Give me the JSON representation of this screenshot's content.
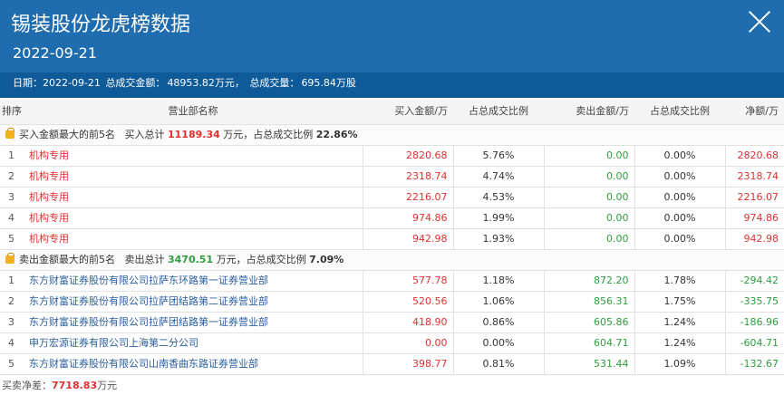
{
  "header": {
    "title": "锡装股份龙虎榜数据",
    "date": "2022-09-21",
    "summary": {
      "date_label": "日期：2022-09-21",
      "amount_label": "总成交金额：",
      "amount_value": "48953.82万元，",
      "volume_label": "总成交量：",
      "volume_value": "695.84万股"
    }
  },
  "table": {
    "headers": {
      "rank": "排序",
      "name": "营业部名称",
      "buy_amount": "买入金额/万",
      "buy_ratio": "占总成交比例",
      "sell_amount": "卖出金额/万",
      "sell_ratio": "占总成交比例",
      "net": "净额/万"
    },
    "buy_group": {
      "label": "买入金额最大的前5名",
      "total_label": "买入总计",
      "total_value": "11189.34",
      "unit_label": "万元，占总成交比例",
      "ratio_value": "22.86%",
      "rows": [
        {
          "rank": "1",
          "name": "机构专用",
          "buy": "2820.68",
          "buy_pct": "5.76%",
          "sell": "0.00",
          "sell_pct": "0.00%",
          "net": "2820.68"
        },
        {
          "rank": "2",
          "name": "机构专用",
          "buy": "2318.74",
          "buy_pct": "4.74%",
          "sell": "0.00",
          "sell_pct": "0.00%",
          "net": "2318.74"
        },
        {
          "rank": "3",
          "name": "机构专用",
          "buy": "2216.07",
          "buy_pct": "4.53%",
          "sell": "0.00",
          "sell_pct": "0.00%",
          "net": "2216.07"
        },
        {
          "rank": "4",
          "name": "机构专用",
          "buy": "974.86",
          "buy_pct": "1.99%",
          "sell": "0.00",
          "sell_pct": "0.00%",
          "net": "974.86"
        },
        {
          "rank": "5",
          "name": "机构专用",
          "buy": "942.98",
          "buy_pct": "1.93%",
          "sell": "0.00",
          "sell_pct": "0.00%",
          "net": "942.98"
        }
      ]
    },
    "sell_group": {
      "label": "卖出金额最大的前5名",
      "total_label": "卖出总计",
      "total_value": "3470.51",
      "unit_label": "万元，占总成交比例",
      "ratio_value": "7.09%",
      "rows": [
        {
          "rank": "1",
          "name": "东方财富证券股份有限公司拉萨东环路第一证券营业部",
          "buy": "577.78",
          "buy_pct": "1.18%",
          "sell": "872.20",
          "sell_pct": "1.78%",
          "net": "-294.42"
        },
        {
          "rank": "2",
          "name": "东方财富证券股份有限公司拉萨团结路第二证券营业部",
          "buy": "520.56",
          "buy_pct": "1.06%",
          "sell": "856.31",
          "sell_pct": "1.75%",
          "net": "-335.75"
        },
        {
          "rank": "3",
          "name": "东方财富证券股份有限公司拉萨团结路第一证券营业部",
          "buy": "418.90",
          "buy_pct": "0.86%",
          "sell": "605.86",
          "sell_pct": "1.24%",
          "net": "-186.96"
        },
        {
          "rank": "4",
          "name": "申万宏源证券有限公司上海第二分公司",
          "buy": "0.00",
          "buy_pct": "0.00%",
          "sell": "604.71",
          "sell_pct": "1.24%",
          "net": "-604.71"
        },
        {
          "rank": "5",
          "name": "东方财富证券股份有限公司山南香曲东路证券营业部",
          "buy": "398.77",
          "buy_pct": "0.81%",
          "sell": "531.44",
          "sell_pct": "1.09%",
          "net": "-132.67"
        }
      ]
    }
  },
  "footer": {
    "label": "买卖净差：",
    "value": "7718.83",
    "unit": "万元"
  },
  "colors": {
    "header_bg": "#1f6cae",
    "positive": "#e03131",
    "negative": "#2e9e3e"
  }
}
